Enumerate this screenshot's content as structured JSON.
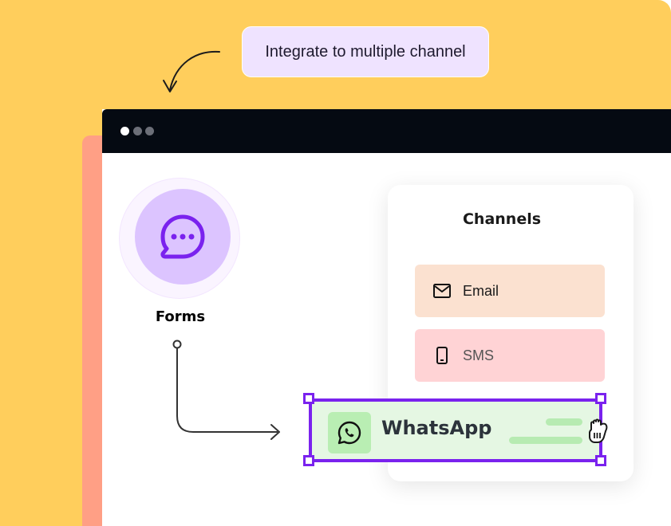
{
  "callout": {
    "text": "Integrate to multiple channel"
  },
  "window": {
    "dots": [
      "white-dot",
      "gray-dot",
      "gray-dot"
    ]
  },
  "forms": {
    "label": "Forms",
    "icon": "chat-bubble-icon"
  },
  "channels": {
    "title": "Channels",
    "items": [
      {
        "label": "Email",
        "icon": "mail-icon",
        "color": "#fbe1d0"
      },
      {
        "label": "SMS",
        "icon": "phone-icon",
        "color": "#ffd3d5"
      }
    ]
  },
  "whatsapp": {
    "label": "WhatsApp",
    "icon": "whatsapp-icon",
    "selection_color": "#7a22ee",
    "background": "#e5f7e3"
  },
  "colors": {
    "background": "#ffce5c",
    "accent_panel": "#ff9f85",
    "titlebar": "#050a12",
    "forms_circle": "#dcc4ff"
  }
}
